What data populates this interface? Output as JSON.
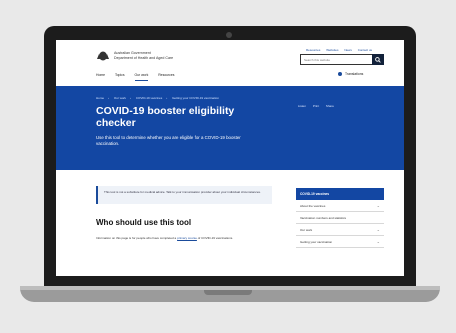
{
  "header": {
    "govt_line1": "Australian Government",
    "govt_line2": "Department of Health and Aged Care",
    "top_links": [
      "Resources",
      "Websites",
      "News",
      "Contact us"
    ],
    "search_placeholder": "Search this website",
    "nav": [
      "Home",
      "Topics",
      "Our work",
      "Resources"
    ],
    "translate_label": "Translations"
  },
  "hero": {
    "breadcrumbs": [
      "Home",
      "Our work",
      "COVID-19 vaccines",
      "Getting your COVID-19 vaccination"
    ],
    "title": "COVID-19 booster eligibility checker",
    "lead": "Use this tool to determine whether you are eligible for a COVID-19 booster vaccination.",
    "share": [
      "Listen",
      "Print",
      "Share"
    ]
  },
  "notice": {
    "text": "This tool is not a substitute for medical advice. Talk to your immunisation provider about your individual circumstances."
  },
  "main": {
    "heading": "Who should use this tool",
    "para_before": "Information on this page is for people who have completed a ",
    "para_link": "primary course",
    "para_after": " of COVID-19 vaccinations."
  },
  "sidebar": {
    "title": "COVID-19 vaccines",
    "items": [
      "About the vaccines",
      "Vaccination numbers and statistics",
      "Our work",
      "Getting your vaccination"
    ]
  },
  "colors": {
    "brand_blue": "#1347a3",
    "link_blue": "#1a4b9b",
    "device_dark": "#1c1c1c"
  }
}
